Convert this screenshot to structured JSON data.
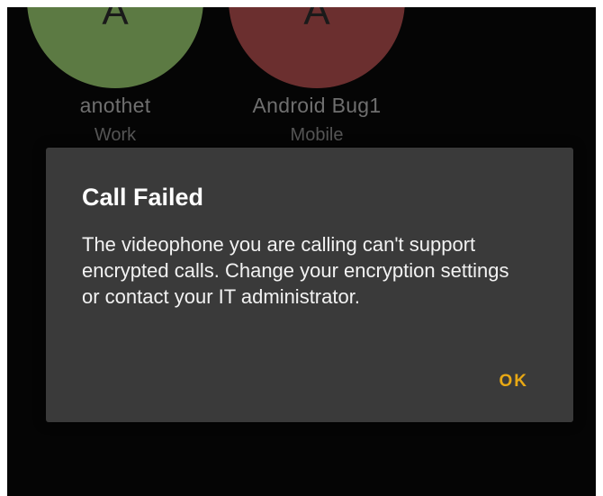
{
  "contacts": [
    {
      "avatar_letter": "A",
      "name": "anothet",
      "type": "Work",
      "avatar_color": "#5c7a43"
    },
    {
      "avatar_letter": "A",
      "name": "Android Bug1",
      "type": "Mobile",
      "avatar_color": "#6b2f2f"
    }
  ],
  "dialog": {
    "title": "Call Failed",
    "message": "The videophone you are calling can't support encrypted calls. Change your encryption settings or contact your IT administrator.",
    "ok_label": "OK",
    "accent_color": "#e8a814"
  }
}
